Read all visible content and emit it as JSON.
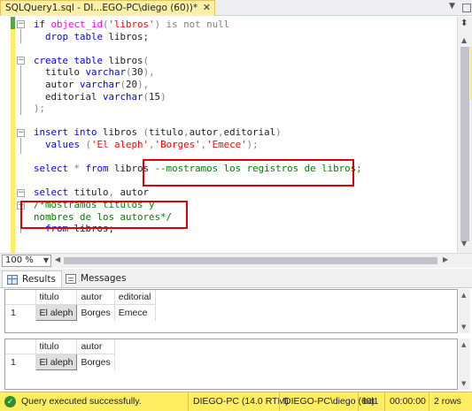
{
  "tab": {
    "title": "SQLQuery1.sql - DI...EGO-PC\\diego (60))*",
    "close": "✕"
  },
  "editor": {
    "lines": [
      [
        {
          "t": "if ",
          "c": "kw"
        },
        {
          "t": "object_id",
          "c": "fn"
        },
        {
          "t": "(",
          "c": "gray"
        },
        {
          "t": "'libros'",
          "c": "str"
        },
        {
          "t": ") ",
          "c": "gray"
        },
        {
          "t": "is not null",
          "c": "gray"
        }
      ],
      [
        {
          "t": "  drop table ",
          "c": "kw"
        },
        {
          "t": "libros;",
          "c": "txt"
        }
      ],
      [],
      [
        {
          "t": "create table ",
          "c": "kw"
        },
        {
          "t": "libros",
          "c": "txt"
        },
        {
          "t": "(",
          "c": "gray"
        }
      ],
      [
        {
          "t": "  titulo ",
          "c": "txt"
        },
        {
          "t": "varchar",
          "c": "kw"
        },
        {
          "t": "(",
          "c": "gray"
        },
        {
          "t": "30",
          "c": "txt"
        },
        {
          "t": "),",
          "c": "gray"
        }
      ],
      [
        {
          "t": "  autor ",
          "c": "txt"
        },
        {
          "t": "varchar",
          "c": "kw"
        },
        {
          "t": "(",
          "c": "gray"
        },
        {
          "t": "20",
          "c": "txt"
        },
        {
          "t": "),",
          "c": "gray"
        }
      ],
      [
        {
          "t": "  editorial ",
          "c": "txt"
        },
        {
          "t": "varchar",
          "c": "kw"
        },
        {
          "t": "(",
          "c": "gray"
        },
        {
          "t": "15",
          "c": "txt"
        },
        {
          "t": ")",
          "c": "gray"
        }
      ],
      [
        {
          "t": ");",
          "c": "gray"
        }
      ],
      [],
      [
        {
          "t": "insert into ",
          "c": "kw"
        },
        {
          "t": "libros ",
          "c": "txt"
        },
        {
          "t": "(",
          "c": "gray"
        },
        {
          "t": "titulo",
          "c": "txt"
        },
        {
          "t": ",",
          "c": "gray"
        },
        {
          "t": "autor",
          "c": "txt"
        },
        {
          "t": ",",
          "c": "gray"
        },
        {
          "t": "editorial",
          "c": "txt"
        },
        {
          "t": ")",
          "c": "gray"
        }
      ],
      [
        {
          "t": "  values ",
          "c": "kw"
        },
        {
          "t": "(",
          "c": "gray"
        },
        {
          "t": "'El aleph'",
          "c": "str"
        },
        {
          "t": ",",
          "c": "gray"
        },
        {
          "t": "'Borges'",
          "c": "str"
        },
        {
          "t": ",",
          "c": "gray"
        },
        {
          "t": "'Emece'",
          "c": "str"
        },
        {
          "t": ");",
          "c": "gray"
        }
      ],
      [],
      [
        {
          "t": "select ",
          "c": "kw"
        },
        {
          "t": "* ",
          "c": "gray"
        },
        {
          "t": "from ",
          "c": "kw"
        },
        {
          "t": "libros ",
          "c": "txt"
        },
        {
          "t": "--mostramos los registros de libros;",
          "c": "cm"
        }
      ],
      [],
      [
        {
          "t": "select ",
          "c": "kw"
        },
        {
          "t": "titulo",
          "c": "txt"
        },
        {
          "t": ", ",
          "c": "gray"
        },
        {
          "t": "autor",
          "c": "txt"
        }
      ],
      [
        {
          "t": "/*mostramos títulos y",
          "c": "cm"
        }
      ],
      [
        {
          "t": "nombres de los autores*/",
          "c": "cm"
        }
      ],
      [
        {
          "t": "  from ",
          "c": "kw"
        },
        {
          "t": "libros;",
          "c": "txt"
        }
      ]
    ]
  },
  "zoom": {
    "value": "100 %"
  },
  "results_tabs": {
    "results": "Results",
    "messages": "Messages"
  },
  "grid1": {
    "columns": [
      "titulo",
      "autor",
      "editorial"
    ],
    "rows": [
      {
        "num": "1",
        "cells": [
          "El aleph",
          "Borges",
          "Emece"
        ]
      }
    ]
  },
  "grid2": {
    "columns": [
      "titulo",
      "autor"
    ],
    "rows": [
      {
        "num": "1",
        "cells": [
          "El aleph",
          "Borges"
        ]
      }
    ]
  },
  "status": {
    "message": "Query executed successfully.",
    "server": "DIEGO-PC (14.0 RTM)",
    "user": "DIEGO-PC\\diego (60)",
    "database": "bd1",
    "elapsed": "00:00:00",
    "rows": "2 rows"
  },
  "colors": {
    "status_bar": "#ffee62",
    "keyword": "#0000ff",
    "string": "#ff0000",
    "comment": "#008000",
    "function": "#ff00ff",
    "highlight_box": "#e00000"
  }
}
